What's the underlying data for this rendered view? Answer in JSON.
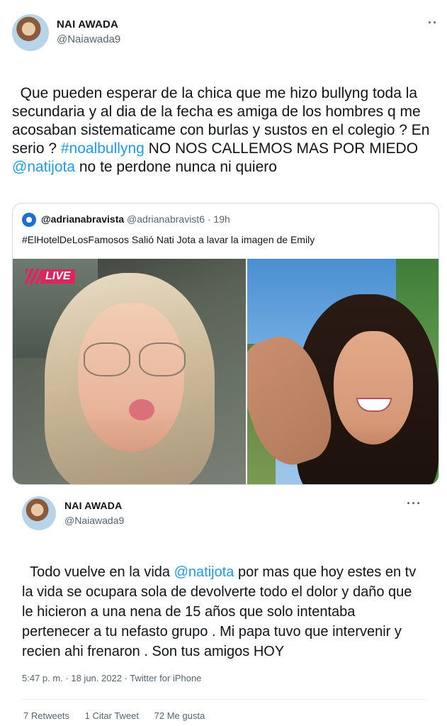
{
  "tweet1": {
    "name": "NAI AWADA",
    "handle": "@Naiawada9",
    "more": "··",
    "text_before": "Que pueden esperar de la chica que me hizo bullyng toda la secundaria y al dia de la fecha es amiga de los hombres q me acosaban sistematicame con burlas y sustos en el colegio ? En serio ? ",
    "hashtag": "#noalbullyng",
    "text_middle": " NO NOS CALLEMOS MAS POR MIEDO ",
    "mention": "@natijota",
    "text_after": " no te perdone nunca ni quiero"
  },
  "quote": {
    "name": "@adrianabravista",
    "handle": "@adrianabravist6",
    "time": "· 19h",
    "text": "#ElHotelDeLosFamosos Salió Nati Jota a lavar la imagen de Emily",
    "live_badge": "LIVE"
  },
  "tweet2": {
    "name": "NAI AWADA",
    "handle": "@Naiawada9",
    "more": "···",
    "text_before": "Todo vuelve en la vida ",
    "mention": "@natijota",
    "text_after": " por mas que hoy estes en tv la vida se ocupara sola de devolverte todo el dolor y daño que le hicieron a una nena de 15 años que solo intentaba pertenecer a tu nefasto grupo . Mi papa tuvo que intervenir y recien ahi frenaron . Son tus amigos HOY",
    "meta": "5:47 p. m. · 18 jun. 2022 · Twitter for iPhone",
    "stats": {
      "retweets": "7 Retweets",
      "quotes": "1 Citar Tweet",
      "likes": "72 Me gusta"
    }
  },
  "colors": {
    "link": "#1d9bf0",
    "text": "#0f1419",
    "secondary": "#536471",
    "border": "#cfd9de",
    "live": "#e0245e"
  }
}
